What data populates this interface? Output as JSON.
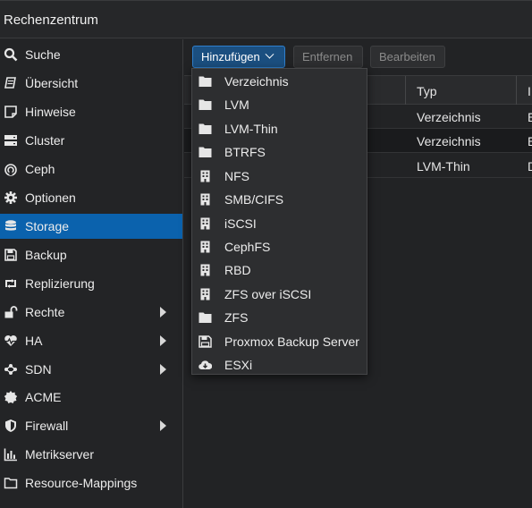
{
  "header": {
    "title": "Rechenzentrum"
  },
  "sidebar": {
    "items": [
      {
        "label": "Suche",
        "icon": "search-icon"
      },
      {
        "label": "Übersicht",
        "icon": "book-icon"
      },
      {
        "label": "Hinweise",
        "icon": "note-icon"
      },
      {
        "label": "Cluster",
        "icon": "server-icon"
      },
      {
        "label": "Ceph",
        "icon": "ceph-icon"
      },
      {
        "label": "Optionen",
        "icon": "gear-icon"
      },
      {
        "label": "Storage",
        "icon": "database-icon",
        "active": true
      },
      {
        "label": "Backup",
        "icon": "floppy-icon"
      },
      {
        "label": "Replizierung",
        "icon": "retweet-icon"
      },
      {
        "label": "Rechte",
        "icon": "unlock-icon",
        "submenu": true
      },
      {
        "label": "HA",
        "icon": "heartbeat-icon",
        "submenu": true
      },
      {
        "label": "SDN",
        "icon": "network-icon",
        "submenu": true
      },
      {
        "label": "ACME",
        "icon": "certificate-icon"
      },
      {
        "label": "Firewall",
        "icon": "shield-icon",
        "submenu": true
      },
      {
        "label": "Metrikserver",
        "icon": "bar-chart-icon"
      },
      {
        "label": "Resource-Mappings",
        "icon": "folder-icon"
      }
    ]
  },
  "toolbar": {
    "add_label": "Hinzufügen",
    "remove_label": "Entfernen",
    "edit_label": "Bearbeiten"
  },
  "grid": {
    "columns": [
      "Typ",
      "I"
    ],
    "rows": [
      {
        "typ": "Verzeichnis",
        "next": "E"
      },
      {
        "typ": "Verzeichnis",
        "next": "E"
      },
      {
        "typ": "LVM-Thin",
        "next": "D"
      }
    ]
  },
  "dropdown": {
    "items": [
      {
        "label": "Verzeichnis",
        "icon": "folder-icon"
      },
      {
        "label": "LVM",
        "icon": "folder-icon"
      },
      {
        "label": "LVM-Thin",
        "icon": "folder-icon"
      },
      {
        "label": "BTRFS",
        "icon": "folder-icon"
      },
      {
        "label": "NFS",
        "icon": "building-icon"
      },
      {
        "label": "SMB/CIFS",
        "icon": "building-icon"
      },
      {
        "label": "iSCSI",
        "icon": "building-icon"
      },
      {
        "label": "CephFS",
        "icon": "building-icon"
      },
      {
        "label": "RBD",
        "icon": "building-icon"
      },
      {
        "label": "ZFS over iSCSI",
        "icon": "building-icon"
      },
      {
        "label": "ZFS",
        "icon": "folder-icon"
      },
      {
        "label": "Proxmox Backup Server",
        "icon": "floppy-icon"
      },
      {
        "label": "ESXi",
        "icon": "cloud-download-icon"
      }
    ]
  },
  "colors": {
    "accent": "#0b62ad",
    "background": "#232426",
    "menu": "#2d2e30"
  }
}
